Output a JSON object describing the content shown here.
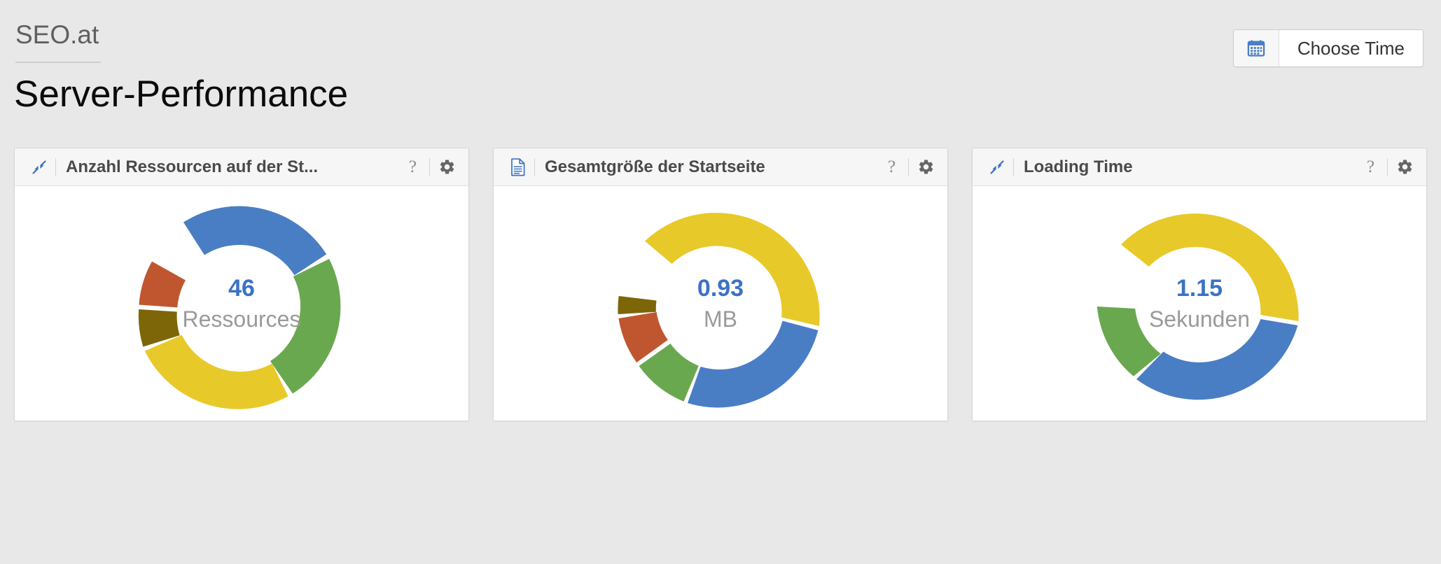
{
  "header": {
    "brand": "SEO.at",
    "title": "Server-Performance",
    "choose_time": {
      "label": "Choose Time",
      "icon": "calendar-icon",
      "icon_color": "#4a7ec4"
    }
  },
  "colors": {
    "blue": "#4a7ec4",
    "green": "#6aa84f",
    "yellow": "#e8c92a",
    "olive": "#7d6608",
    "red": "#c0562f",
    "value_blue": "#3b72c4",
    "unit_gray": "#9a9a9a",
    "page_bg": "#e8e8e8",
    "card_head_bg": "#f6f6f6"
  },
  "cards": [
    {
      "id": "anzahl-ressourcen",
      "lead_icon": "compress-arrows-icon",
      "title": "Anzahl Ressourcen auf der St...",
      "help_label": "?",
      "gear_label": "gear-icon",
      "center_value": "46",
      "center_unit": "Ressources"
    },
    {
      "id": "gesamtgroesse-startseite",
      "lead_icon": "document-icon",
      "title": "Gesamtgröße der Startseite",
      "help_label": "?",
      "gear_label": "gear-icon",
      "center_value": "0.93",
      "center_unit": "MB"
    },
    {
      "id": "loading-time",
      "lead_icon": "compress-arrows-icon",
      "title": "Loading Time",
      "help_label": "?",
      "gear_label": "gear-icon",
      "center_value": "1.15",
      "center_unit": "Sekunden"
    }
  ],
  "chart_data": [
    {
      "type": "pie",
      "variant": "donut",
      "title": "Anzahl Ressourcen auf der St...",
      "center_value": "46",
      "center_unit": "Ressources",
      "total": 46,
      "labels": [
        "blue",
        "green",
        "yellow",
        "olive",
        "red"
      ],
      "values": [
        36,
        25,
        19,
        11,
        9
      ],
      "colors": [
        "#4a7ec4",
        "#6aa84f",
        "#e8c92a",
        "#7d6608",
        "#c0562f"
      ],
      "start_angle_deg": -60,
      "legend": "none",
      "grid": false
    },
    {
      "type": "pie",
      "variant": "donut",
      "title": "Gesamtgröße der Startseite",
      "center_value": "0.93",
      "center_unit": "MB",
      "total": 0.93,
      "labels": [
        "yellow",
        "blue",
        "green",
        "red",
        "olive"
      ],
      "values": [
        40,
        35,
        8,
        11,
        6
      ],
      "colors": [
        "#e8c92a",
        "#4a7ec4",
        "#6aa84f",
        "#c0562f",
        "#7d6608"
      ],
      "start_angle_deg": -68,
      "legend": "none",
      "grid": false
    },
    {
      "type": "pie",
      "variant": "donut",
      "title": "Loading Time",
      "center_value": "1.15",
      "center_unit": "Sekunden",
      "total": 1.15,
      "labels": [
        "yellow",
        "blue",
        "green"
      ],
      "values": [
        38,
        46,
        16
      ],
      "colors": [
        "#e8c92a",
        "#4a7ec4",
        "#6aa84f"
      ],
      "start_angle_deg": -64,
      "legend": "none",
      "grid": false
    }
  ]
}
